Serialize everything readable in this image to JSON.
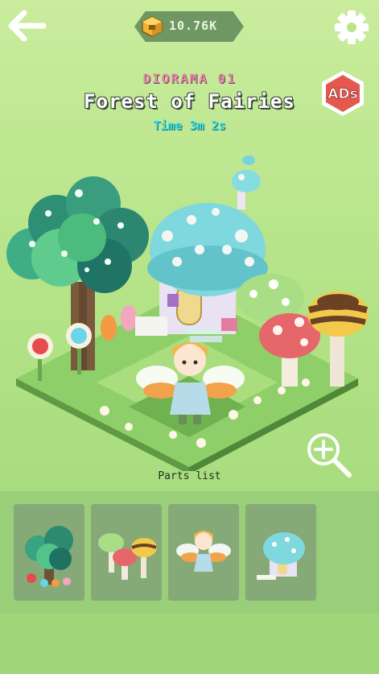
{
  "header": {
    "currency_amount": "10.76K",
    "icons": {
      "back": "back-arrow-icon",
      "currency": "gold-cube-icon",
      "settings": "gear-icon"
    }
  },
  "diorama": {
    "label": "DIORAMA 01",
    "title": "Forest of Fairies",
    "time": "Time 3m 2s"
  },
  "ads_button": {
    "label": "ADs",
    "color": "#e5584f"
  },
  "zoom_icon": "zoom-in-icon",
  "parts": {
    "label": "Parts list",
    "items": [
      {
        "icon": "tree-part-icon"
      },
      {
        "icon": "mushrooms-part-icon"
      },
      {
        "icon": "fairy-part-icon"
      },
      {
        "icon": "mushroom-house-part-icon"
      }
    ]
  },
  "colors": {
    "accent_pink": "#e58ca9",
    "time_cyan": "#3fe2e3",
    "tray": "#99cf79",
    "card": "#86a978"
  }
}
